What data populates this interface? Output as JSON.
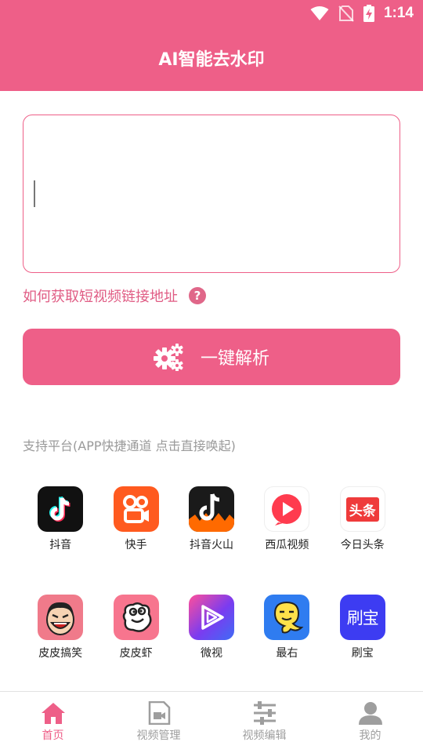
{
  "status": {
    "time": "1:14"
  },
  "app": {
    "title": "AI智能去水印"
  },
  "input": {
    "value": "",
    "placeholder": ""
  },
  "help": {
    "text": "如何获取短视频链接地址",
    "icon_char": "?"
  },
  "parse_button": {
    "label": "一键解析",
    "icon": "gears-icon"
  },
  "platforms": {
    "caption": "支持平台(APP快捷通道 点击直接唤起)",
    "items": [
      {
        "label": "抖音",
        "icon": "douyin-icon",
        "color": "#111111"
      },
      {
        "label": "快手",
        "icon": "kuaishou-icon",
        "color": "#ff5a1f"
      },
      {
        "label": "抖音火山",
        "icon": "huoshan-icon",
        "color": "#1a1a1a"
      },
      {
        "label": "西瓜视频",
        "icon": "xigua-icon",
        "color": "#ff3b4e"
      },
      {
        "label": "今日头条",
        "icon": "toutiao-icon",
        "color": "#ef3b3b",
        "glyph": "头条"
      },
      {
        "label": "皮皮搞笑",
        "icon": "pipigaoxiao-icon",
        "color": "#f07a8a"
      },
      {
        "label": "皮皮虾",
        "icon": "pipixia-icon",
        "color": "#f7758e"
      },
      {
        "label": "微视",
        "icon": "weishi-icon",
        "color": "#8e3cf0"
      },
      {
        "label": "最右",
        "icon": "zuiyou-icon",
        "color": "#2f7cf0"
      },
      {
        "label": "刷宝",
        "icon": "shuabao-icon",
        "color": "#3d3cf2",
        "glyph": "刷宝"
      }
    ]
  },
  "nav": {
    "items": [
      {
        "label": "首页",
        "icon": "home-icon",
        "active": true
      },
      {
        "label": "视频管理",
        "icon": "video-file-icon",
        "active": false
      },
      {
        "label": "视频编辑",
        "icon": "sliders-icon",
        "active": false
      },
      {
        "label": "我的",
        "icon": "user-icon",
        "active": false
      }
    ]
  },
  "colors": {
    "accent": "#ee5f88",
    "inactive": "#9e9e9e"
  }
}
